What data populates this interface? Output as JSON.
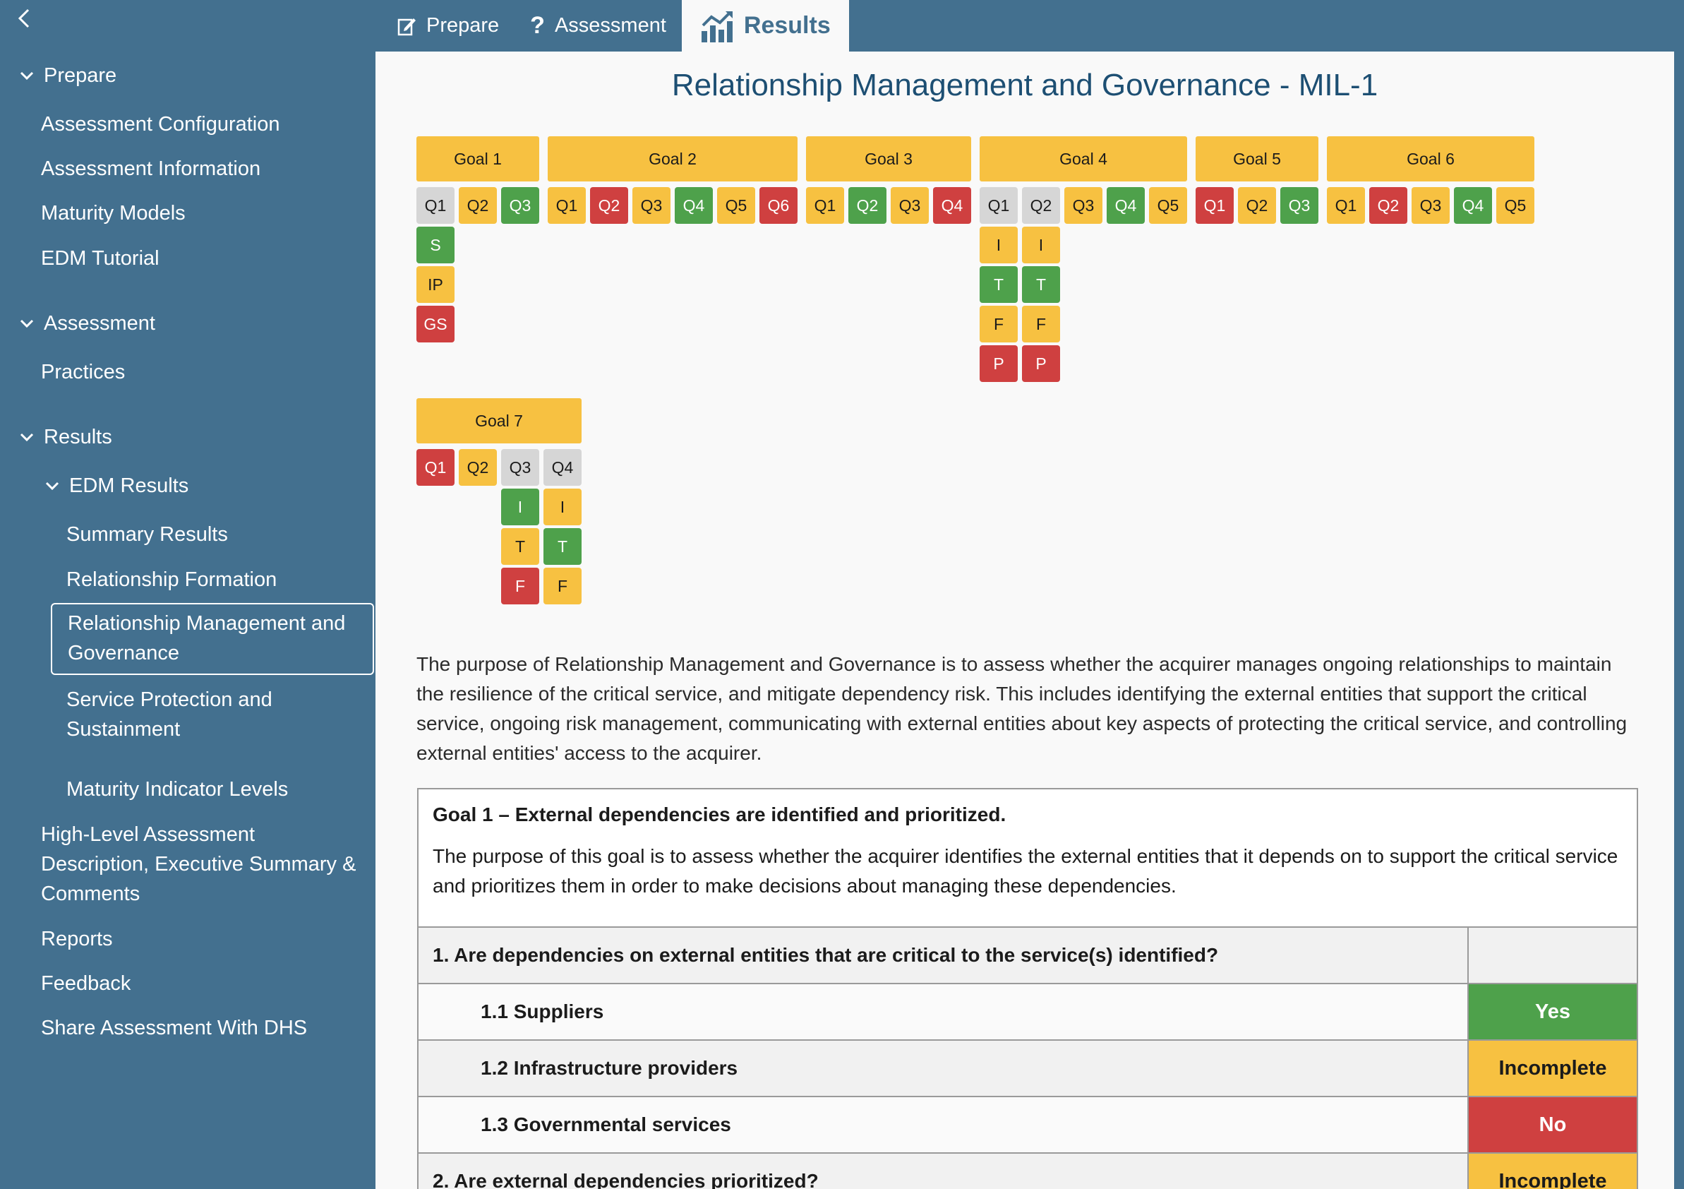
{
  "topbar": {
    "tabs": [
      {
        "label": "Prepare",
        "icon": "edit-icon"
      },
      {
        "label": "Assessment",
        "icon": "question-icon"
      },
      {
        "label": "Results",
        "icon": "chart-icon"
      }
    ]
  },
  "sidebar": {
    "prepare": {
      "label": "Prepare",
      "items": [
        "Assessment Configuration",
        "Assessment Information",
        "Maturity Models",
        "EDM Tutorial"
      ]
    },
    "assessment": {
      "label": "Assessment",
      "items": [
        "Practices"
      ]
    },
    "results": {
      "label": "Results",
      "edm": {
        "label": "EDM Results",
        "items": [
          "Summary Results",
          "Relationship Formation"
        ],
        "active": [
          "Relationship Management and",
          "Governance"
        ],
        "after": [
          [
            "Service Protection and",
            "Sustainment"
          ],
          [
            "Maturity Indicator Levels"
          ]
        ]
      },
      "items": [
        [
          "High-Level Assessment",
          "Description, Executive Summary &",
          "Comments"
        ],
        [
          "Reports"
        ],
        [
          "Feedback"
        ],
        [
          "Share Assessment With DHS"
        ]
      ]
    }
  },
  "main": {
    "title": "Relationship Management and Governance - MIL-1",
    "goals": [
      {
        "label": "Goal 1",
        "questions": [
          {
            "q": "Q1",
            "status": "gray",
            "subs": [
              {
                "t": "S",
                "s": "green"
              },
              {
                "t": "IP",
                "s": "yellow"
              },
              {
                "t": "GS",
                "s": "red"
              }
            ]
          },
          {
            "q": "Q2",
            "status": "yellow"
          },
          {
            "q": "Q3",
            "status": "green"
          }
        ]
      },
      {
        "label": "Goal 2",
        "questions": [
          {
            "q": "Q1",
            "status": "yellow"
          },
          {
            "q": "Q2",
            "status": "red"
          },
          {
            "q": "Q3",
            "status": "yellow"
          },
          {
            "q": "Q4",
            "status": "green"
          },
          {
            "q": "Q5",
            "status": "yellow"
          },
          {
            "q": "Q6",
            "status": "red"
          }
        ]
      },
      {
        "label": "Goal 3",
        "questions": [
          {
            "q": "Q1",
            "status": "yellow"
          },
          {
            "q": "Q2",
            "status": "green"
          },
          {
            "q": "Q3",
            "status": "yellow"
          },
          {
            "q": "Q4",
            "status": "red"
          }
        ]
      },
      {
        "label": "Goal 4",
        "questions": [
          {
            "q": "Q1",
            "status": "gray",
            "subs": [
              {
                "t": "I",
                "s": "yellow"
              },
              {
                "t": "T",
                "s": "green"
              },
              {
                "t": "F",
                "s": "yellow"
              },
              {
                "t": "P",
                "s": "red"
              }
            ]
          },
          {
            "q": "Q2",
            "status": "gray",
            "subs": [
              {
                "t": "I",
                "s": "yellow"
              },
              {
                "t": "T",
                "s": "green"
              },
              {
                "t": "F",
                "s": "yellow"
              },
              {
                "t": "P",
                "s": "red"
              }
            ]
          },
          {
            "q": "Q3",
            "status": "yellow"
          },
          {
            "q": "Q4",
            "status": "green"
          },
          {
            "q": "Q5",
            "status": "yellow"
          }
        ]
      },
      {
        "label": "Goal 5",
        "questions": [
          {
            "q": "Q1",
            "status": "red"
          },
          {
            "q": "Q2",
            "status": "yellow"
          },
          {
            "q": "Q3",
            "status": "green"
          }
        ]
      },
      {
        "label": "Goal 6",
        "questions": [
          {
            "q": "Q1",
            "status": "yellow"
          },
          {
            "q": "Q2",
            "status": "red"
          },
          {
            "q": "Q3",
            "status": "yellow"
          },
          {
            "q": "Q4",
            "status": "green"
          },
          {
            "q": "Q5",
            "status": "yellow"
          }
        ]
      },
      {
        "label": "Goal 7",
        "questions": [
          {
            "q": "Q1",
            "status": "red"
          },
          {
            "q": "Q2",
            "status": "yellow"
          },
          {
            "q": "Q3",
            "status": "gray",
            "subs": [
              {
                "t": "I",
                "s": "green"
              },
              {
                "t": "T",
                "s": "yellow"
              },
              {
                "t": "F",
                "s": "red"
              }
            ]
          },
          {
            "q": "Q4",
            "status": "gray",
            "subs": [
              {
                "t": "I",
                "s": "yellow"
              },
              {
                "t": "T",
                "s": "green"
              },
              {
                "t": "F",
                "s": "yellow"
              }
            ]
          }
        ]
      }
    ],
    "description": "The purpose of Relationship Management and Governance is to assess whether the acquirer manages ongoing relationships to maintain the resilience of the critical service, and mitigate dependency risk. This includes identifying the external entities that support the critical service, ongoing risk management, communicating with external entities about key aspects of protecting the critical service, and controlling external entities' access to the acquirer.",
    "goal_detail": {
      "heading": "Goal 1 – External dependencies are identified and prioritized.",
      "text": "The purpose of this goal is to assess whether the acquirer identifies the external entities that it depends on to support the critical service and prioritizes them in order to make decisions about managing these dependencies.",
      "rows": [
        {
          "text": "1. Are dependencies on external entities that are critical to the service(s) identified?",
          "answer": "",
          "sub": false
        },
        {
          "text": "1.1 Suppliers",
          "answer": "Yes",
          "status": "green",
          "sub": true
        },
        {
          "text": "1.2 Infrastructure providers",
          "answer": "Incomplete",
          "status": "yellow",
          "sub": true
        },
        {
          "text": "1.3 Governmental services",
          "answer": "No",
          "status": "red",
          "sub": true
        },
        {
          "text": "2. Are external dependencies prioritized?",
          "answer": "Incomplete",
          "status": "yellow",
          "sub": false
        }
      ]
    }
  },
  "colors": {
    "primary": "#43708f",
    "title": "#1d4f73",
    "green": "#4ea14b",
    "yellow": "#f7c141",
    "red": "#cf4040",
    "gray": "#d6d6d6"
  }
}
